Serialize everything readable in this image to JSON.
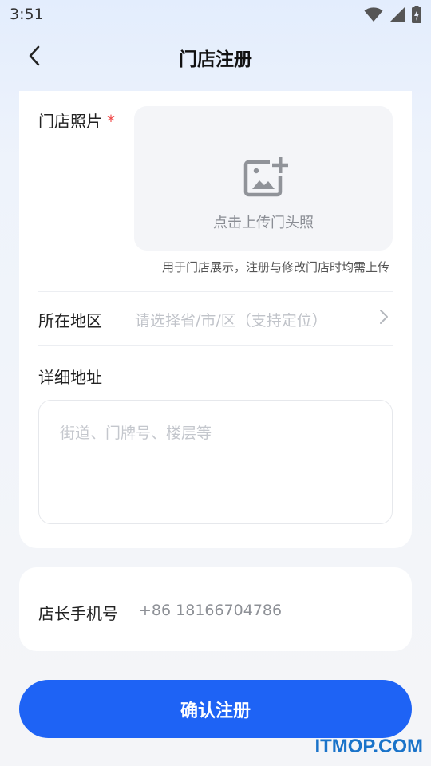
{
  "status_bar": {
    "time": "3:51",
    "icons": [
      "wifi-icon",
      "cell-signal-icon",
      "battery-charging-icon"
    ]
  },
  "header": {
    "title": "门店注册",
    "back_icon": "chevron-left-icon"
  },
  "form": {
    "photo_label": "门店照片",
    "required_mark": "*",
    "upload_icon": "add-photo-icon",
    "upload_text": "点击上传门头照",
    "photo_hint": "用于门店展示，注册与修改门店时均需上传",
    "region_label": "所在地区",
    "region_placeholder": "请选择省/市/区（支持定位）",
    "region_chevron_icon": "chevron-right-icon",
    "address_label": "详细地址",
    "address_placeholder": "街道、门牌号、楼层等",
    "address_value": ""
  },
  "phone": {
    "label": "店长手机号",
    "value": "+86 18166704786"
  },
  "actions": {
    "confirm_label": "确认注册"
  },
  "watermark": "ITMOP.COM",
  "colors": {
    "accent": "#1e63f5",
    "required": "#f04b4b",
    "watermark": "#1a73c9"
  }
}
